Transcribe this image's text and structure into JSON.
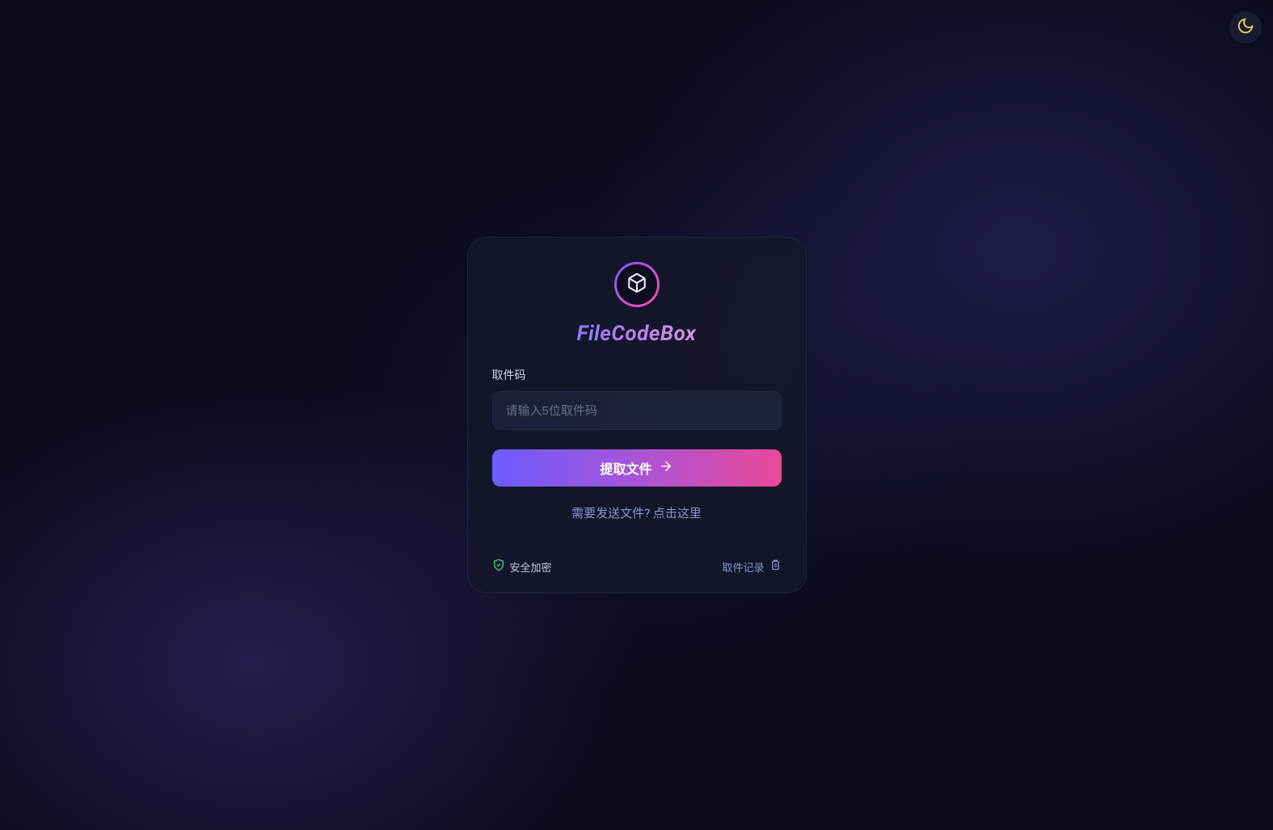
{
  "app": {
    "title": "FileCodeBox"
  },
  "form": {
    "code_label": "取件码",
    "code_placeholder": "请输入5位取件码",
    "submit_label": "提取文件"
  },
  "links": {
    "send_prompt": "需要发送文件? 点击这里",
    "history_label": "取件记录"
  },
  "footer": {
    "secure_label": "安全加密"
  },
  "theme": {
    "mode": "dark"
  },
  "colors": {
    "gradient_start": "#6b5cff",
    "gradient_mid": "#a855d6",
    "gradient_end": "#ec4899",
    "accent_green": "#3dd27a",
    "accent_yellow": "#e8d85a"
  }
}
